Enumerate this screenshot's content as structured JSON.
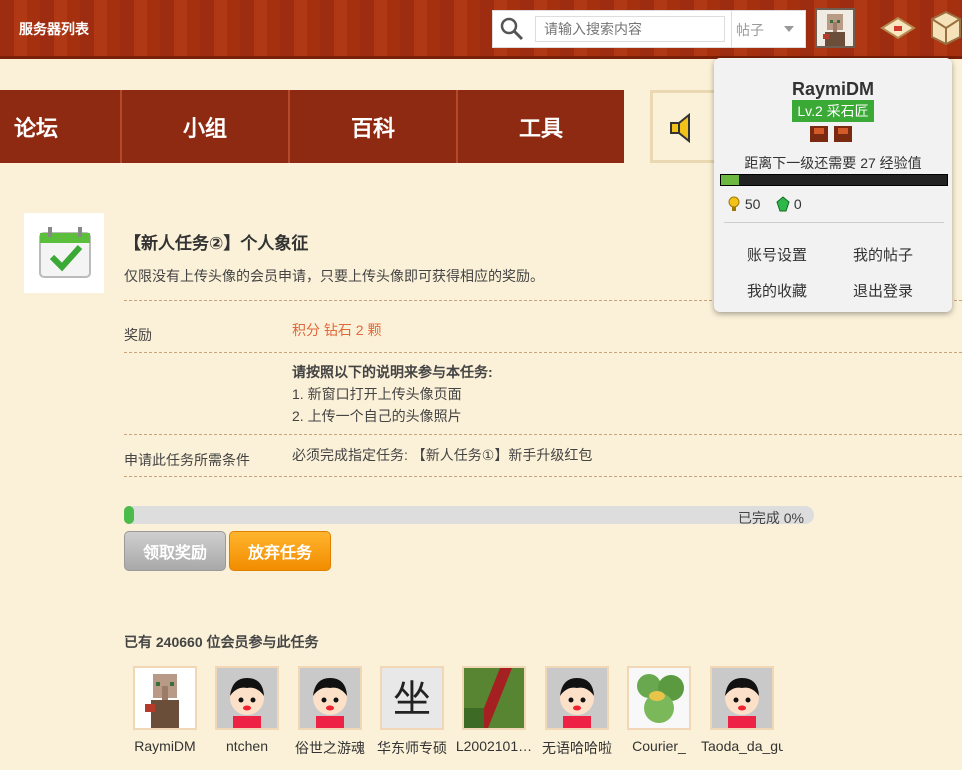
{
  "topbar": {
    "title": "服务器列表",
    "search_placeholder": "请输入搜索内容",
    "search_type": "帖子"
  },
  "nav": {
    "items": [
      "论坛",
      "小组",
      "百科",
      "工具"
    ]
  },
  "task": {
    "title": "【新人任务②】个人象征",
    "description": "仅限没有上传头像的会员申请，只要上传头像即可获得相应的奖励。",
    "reward_label": "奖励",
    "reward_value": "积分 钻石 2 颗",
    "instructions_title": "请按照以下的说明来参与本任务:",
    "instructions": [
      "1. 新窗口打开上传头像页面",
      "2. 上传一个自己的头像照片"
    ],
    "condition_label": "申请此任务所需条件",
    "condition_value": "必须完成指定任务: 【新人任务①】新手升级红包",
    "progress_text": "已完成 0%",
    "progress_percent": 0,
    "claim_button": "领取奖励",
    "quit_button": "放弃任务"
  },
  "participants": {
    "title": "已有 240660 位会员参与此任务",
    "members": [
      "RaymiDM",
      "ntchen",
      "俗世之游魂",
      "华东师专硕",
      "L2002101…",
      "无语哈哈啦",
      "Courier_",
      "Taoda_da_gu…"
    ]
  },
  "user_popup": {
    "username": "RaymiDM",
    "level": "Lv.2 采石匠",
    "exp_text": "距离下一级还需要 27 经验值",
    "exp_fraction": 0.08,
    "points": "50",
    "emeralds": "0",
    "links": [
      "账号设置",
      "我的帖子",
      "我的收藏",
      "退出登录"
    ]
  },
  "colors": {
    "accent_red": "#9e2c10",
    "orange": "#f28c00",
    "green": "#3aa935",
    "reward": "#e0683c"
  }
}
